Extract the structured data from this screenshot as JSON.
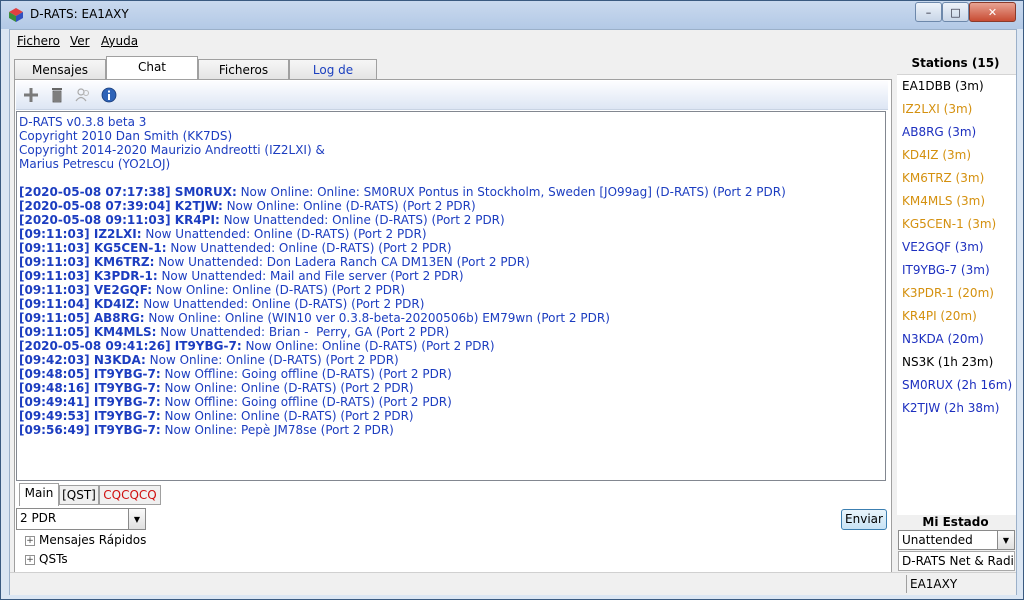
{
  "window": {
    "title": "D-RATS: EA1AXY"
  },
  "menu": [
    "Fichero",
    "Ver",
    "Ayuda"
  ],
  "tabs": [
    {
      "label": "Mensajes"
    },
    {
      "label": "Chat"
    },
    {
      "label": "Ficheros"
    },
    {
      "label": "Log de Eventos"
    }
  ],
  "chat": {
    "header_lines": [
      "D-RATS v0.3.8 beta 3",
      "Copyright 2010 Dan Smith (KK7DS)",
      "Copyright 2014-2020 Maurizio Andreotti (IZ2LXI) &",
      "Marius Petrescu (YO2LOJ)"
    ],
    "messages": [
      {
        "ts": "[2020-05-08 07:17:38]",
        "call": "SM0RUX:",
        "text": " Now Online: Online: SM0RUX Pontus in Stockholm, Sweden [JO99ag] (D-RATS) (Port 2 PDR)"
      },
      {
        "ts": "[2020-05-08 07:39:04]",
        "call": "K2TJW:",
        "text": " Now Online: Online (D-RATS) (Port 2 PDR)"
      },
      {
        "ts": "[2020-05-08 09:11:03]",
        "call": "KR4PI:",
        "text": " Now Unattended: Online (D-RATS) (Port 2 PDR)"
      },
      {
        "ts": "[09:11:03]",
        "call": "IZ2LXI:",
        "text": " Now Unattended: Online (D-RATS) (Port 2 PDR)"
      },
      {
        "ts": "[09:11:03]",
        "call": "KG5CEN-1:",
        "text": " Now Unattended: Online (D-RATS) (Port 2 PDR)"
      },
      {
        "ts": "[09:11:03]",
        "call": "KM6TRZ:",
        "text": " Now Unattended: Don Ladera Ranch CA DM13EN (Port 2 PDR)"
      },
      {
        "ts": "[09:11:03]",
        "call": "K3PDR-1:",
        "text": " Now Unattended: Mail and File server (Port 2 PDR)"
      },
      {
        "ts": "[09:11:03]",
        "call": "VE2GQF:",
        "text": " Now Online: Online (D-RATS) (Port 2 PDR)"
      },
      {
        "ts": "[09:11:04]",
        "call": "KD4IZ:",
        "text": " Now Unattended: Online (D-RATS) (Port 2 PDR)"
      },
      {
        "ts": "[09:11:05]",
        "call": "AB8RG:",
        "text": " Now Online: Online (WIN10 ver 0.3.8-beta-20200506b) EM79wn (Port 2 PDR)"
      },
      {
        "ts": "[09:11:05]",
        "call": "KM4MLS:",
        "text": " Now Unattended: Brian -  Perry, GA (Port 2 PDR)"
      },
      {
        "ts": "[2020-05-08 09:41:26]",
        "call": "IT9YBG-7:",
        "text": " Now Online: Online (D-RATS) (Port 2 PDR)"
      },
      {
        "ts": "[09:42:03]",
        "call": "N3KDA:",
        "text": " Now Online: Online (D-RATS) (Port 2 PDR)"
      },
      {
        "ts": "[09:48:05]",
        "call": "IT9YBG-7:",
        "text": " Now Offline: Going offline (D-RATS) (Port 2 PDR)"
      },
      {
        "ts": "[09:48:16]",
        "call": "IT9YBG-7:",
        "text": " Now Online: Online (D-RATS) (Port 2 PDR)"
      },
      {
        "ts": "[09:49:41]",
        "call": "IT9YBG-7:",
        "text": " Now Offline: Going offline (D-RATS) (Port 2 PDR)"
      },
      {
        "ts": "[09:49:53]",
        "call": "IT9YBG-7:",
        "text": " Now Online: Online (D-RATS) (Port 2 PDR)"
      },
      {
        "ts": "[09:56:49]",
        "call": "IT9YBG-7:",
        "text": " Now Online: Pepè JM78se (Port 2 PDR)"
      }
    ]
  },
  "subtabs": [
    "Main",
    "[QST]",
    "CQCQCQ"
  ],
  "port_select": "2 PDR",
  "send_button": "Enviar",
  "expanders": [
    "Mensajes Rápidos",
    "QSTs"
  ],
  "stations": {
    "header": "Stations (15)",
    "items": [
      {
        "label": "EA1DBB (3m)",
        "color": "#000000"
      },
      {
        "label": "IZ2LXI (3m)",
        "color": "#d4900e"
      },
      {
        "label": "AB8RG (3m)",
        "color": "#1c2fbf"
      },
      {
        "label": "KD4IZ (3m)",
        "color": "#d4900e"
      },
      {
        "label": "KM6TRZ (3m)",
        "color": "#d4900e"
      },
      {
        "label": "KM4MLS (3m)",
        "color": "#d4900e"
      },
      {
        "label": "KG5CEN-1 (3m)",
        "color": "#d4900e"
      },
      {
        "label": "VE2GQF (3m)",
        "color": "#1c2fbf"
      },
      {
        "label": "IT9YBG-7 (3m)",
        "color": "#1c2fbf"
      },
      {
        "label": "K3PDR-1 (20m)",
        "color": "#d4900e"
      },
      {
        "label": "KR4PI (20m)",
        "color": "#d4900e"
      },
      {
        "label": "N3KDA (20m)",
        "color": "#1c2fbf"
      },
      {
        "label": "NS3K (1h 23m)",
        "color": "#000000"
      },
      {
        "label": "SM0RUX (2h 16m)",
        "color": "#1c2fbf"
      },
      {
        "label": "K2TJW (2h 38m)",
        "color": "#1c2fbf"
      }
    ]
  },
  "mi_estado": {
    "header": "Mi Estado",
    "value": "Unattended",
    "net": "D-RATS Net & Radio"
  },
  "statusbar": {
    "callsign": "EA1AXY"
  },
  "icons": {
    "add": "plus-icon",
    "clear": "trash-icon",
    "users": "users-icon",
    "info": "info-icon"
  }
}
